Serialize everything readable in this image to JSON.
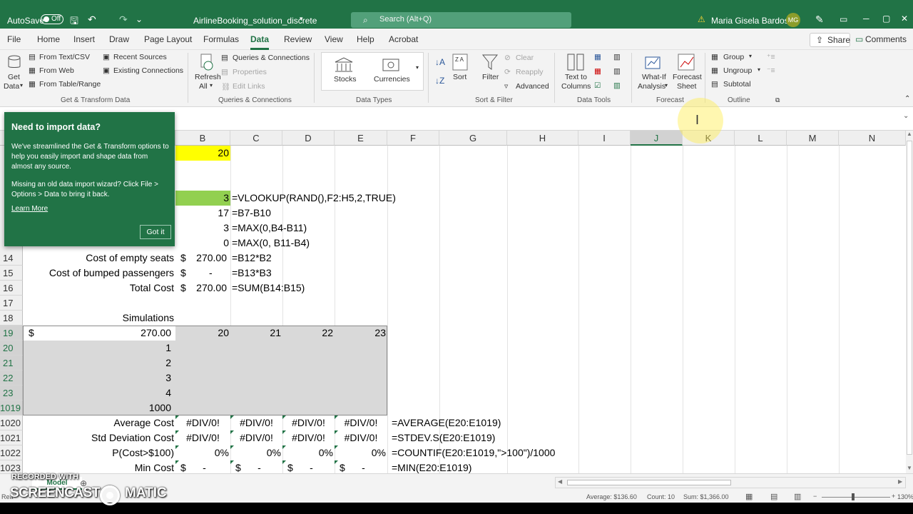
{
  "titlebar": {
    "autosave": "AutoSave",
    "autosave_state": "Off",
    "filename": "AirlineBooking_solution_discrete",
    "search_placeholder": "Search (Alt+Q)",
    "user": "Maria Gisela Bardossy",
    "initials": "MG"
  },
  "tabs": [
    "File",
    "Home",
    "Insert",
    "Draw",
    "Page Layout",
    "Formulas",
    "Data",
    "Review",
    "View",
    "Help",
    "Acrobat"
  ],
  "active_tab": "Data",
  "share": "Share",
  "comments": "Comments",
  "ribbon": {
    "get_data": [
      "Get",
      "Data"
    ],
    "from_text": "From Text/CSV",
    "from_web": "From Web",
    "from_table": "From Table/Range",
    "recent": "Recent Sources",
    "existing": "Existing Connections",
    "group_get": "Get & Transform Data",
    "refresh": [
      "Refresh",
      "All"
    ],
    "queries": "Queries & Connections",
    "properties": "Properties",
    "edit_links": "Edit Links",
    "group_queries": "Queries & Connections",
    "stocks": "Stocks",
    "currencies": "Currencies",
    "group_types": "Data Types",
    "sort": "Sort",
    "filter": "Filter",
    "clear": "Clear",
    "reapply": "Reapply",
    "advanced": "Advanced",
    "group_sort": "Sort & Filter",
    "text_to_columns": [
      "Text to",
      "Columns"
    ],
    "group_tools": "Data Tools",
    "whatif": [
      "What-If",
      "Analysis"
    ],
    "forecast_sheet": [
      "Forecast",
      "Sheet"
    ],
    "group_forecast": "Forecast",
    "group": "Group",
    "ungroup": "Ungroup",
    "subtotal": "Subtotal",
    "group_outline": "Outline"
  },
  "popup": {
    "title": "Need to import data?",
    "p1": "We've streamlined the Get & Transform options to help you easily import and shape data from almost any source.",
    "p2": "Missing an old data import wizard? Click File > Options > Data to bring it back.",
    "learn_more": "Learn More",
    "got_it": "Got it"
  },
  "columns": [
    "B",
    "C",
    "D",
    "E",
    "F",
    "G",
    "H",
    "I",
    "J",
    "K",
    "L",
    "M",
    "N"
  ],
  "selected_column": "J",
  "top_cells": {
    "b_input": "20",
    "b7": "3",
    "f7": "=VLOOKUP(RAND(),F2:H5,2,TRUE)",
    "b11": "17",
    "f11": "=B7-B10",
    "b12": "3",
    "f12": "=MAX(0,B4-B11)",
    "b13": "0",
    "f13": "=MAX(0, B11-B4)"
  },
  "rows": [
    {
      "num": "14",
      "label": "Cost of empty seats",
      "cur": "$",
      "val": "270.00",
      "formula": "=B12*B2"
    },
    {
      "num": "15",
      "label": "Cost of bumped passengers",
      "cur": "$",
      "val": "-",
      "formula": "=B13*B3"
    },
    {
      "num": "16",
      "label": "Total Cost",
      "cur": "$",
      "val": "270.00",
      "formula": "=SUM(B14:B15)"
    },
    {
      "num": "17"
    },
    {
      "num": "18",
      "label": "Simulations"
    }
  ],
  "sim_header": {
    "num": "19",
    "cur": "$",
    "val": "270.00",
    "c": "20",
    "d": "21",
    "e": "22",
    "f": "23"
  },
  "sim_rows": [
    {
      "num": "20",
      "val": "1"
    },
    {
      "num": "21",
      "val": "2"
    },
    {
      "num": "22",
      "val": "3"
    },
    {
      "num": "23",
      "val": "4"
    },
    {
      "num": "1019",
      "val": "1000"
    }
  ],
  "stats": [
    {
      "num": "1020",
      "label": "Average  Cost",
      "vals": [
        "#DIV/0!",
        "#DIV/0!",
        "#DIV/0!",
        "#DIV/0!"
      ],
      "formula": "=AVERAGE(E20:E1019)"
    },
    {
      "num": "1021",
      "label": "Std Deviation Cost",
      "vals": [
        "#DIV/0!",
        "#DIV/0!",
        "#DIV/0!",
        "#DIV/0!"
      ],
      "formula": "=STDEV.S(E20:E1019)"
    },
    {
      "num": "1022",
      "label": "P(Cost>$100)",
      "vals": [
        "0%",
        "0%",
        "0%",
        "0%"
      ],
      "formula": "=COUNTIF(E20:E1019,\">100\")/1000"
    },
    {
      "num": "1023",
      "label": "Min Cost",
      "vals": [
        "$      -",
        "$      -",
        "$      -",
        "$      -"
      ],
      "formula": "=MIN(E20:E1019)"
    }
  ],
  "sheet_tab": "Model",
  "status": {
    "avg": "Average: $136.60",
    "count": "Count: 10",
    "sum": "Sum: $1,366.00",
    "zoom": "130%",
    "ready": "Rea"
  },
  "watermark": {
    "top": "RECORDED WITH",
    "brand_left": "SCREENCAST",
    "brand_right": "MATIC"
  },
  "colors": {
    "excel_green": "#217346",
    "input_yellow": "#ffff00",
    "result_green": "#92d050",
    "sim_gray": "#d9d9d9"
  }
}
